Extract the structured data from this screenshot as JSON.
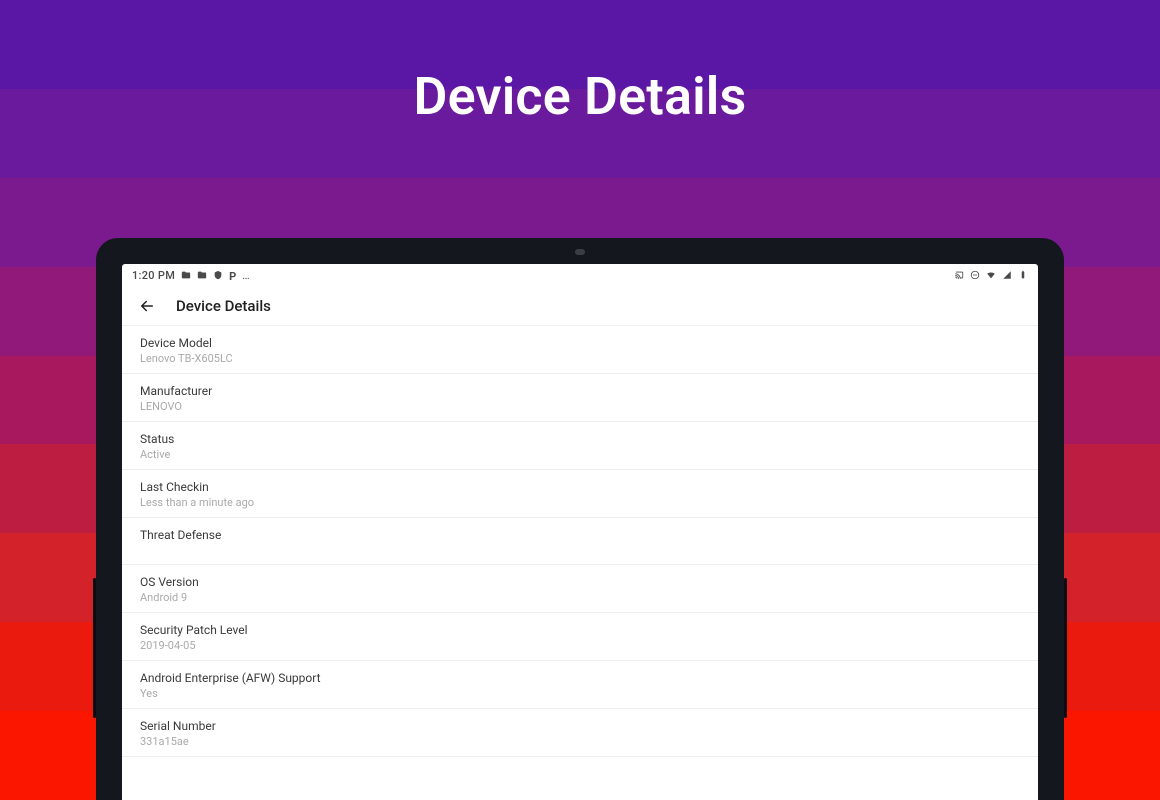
{
  "promo": {
    "title": "Device Details"
  },
  "background_bands": [
    "#5a17a6",
    "#6a1a9c",
    "#7b1a8e",
    "#90197a",
    "#a8185f",
    "#be1d42",
    "#d4222a",
    "#ea1a0f",
    "#fb1600"
  ],
  "statusbar": {
    "time": "1:20 PM",
    "left_icons": [
      "folder-icon",
      "folder-icon",
      "shield-icon",
      "p-icon"
    ],
    "right_icons": [
      "cast-icon",
      "dnd-icon",
      "wifi-icon",
      "signal-icon",
      "battery-icon"
    ]
  },
  "appbar": {
    "title": "Device Details"
  },
  "details": [
    {
      "label": "Device Model",
      "value": "Lenovo TB-X605LC"
    },
    {
      "label": "Manufacturer",
      "value": "LENOVO"
    },
    {
      "label": "Status",
      "value": "Active"
    },
    {
      "label": "Last Checkin",
      "value": "Less than a minute ago"
    },
    {
      "label": "Threat Defense",
      "value": ""
    },
    {
      "label": "OS Version",
      "value": "Android 9"
    },
    {
      "label": "Security Patch Level",
      "value": "2019-04-05"
    },
    {
      "label": "Android Enterprise (AFW) Support",
      "value": "Yes"
    },
    {
      "label": "Serial Number",
      "value": "331a15ae"
    }
  ]
}
